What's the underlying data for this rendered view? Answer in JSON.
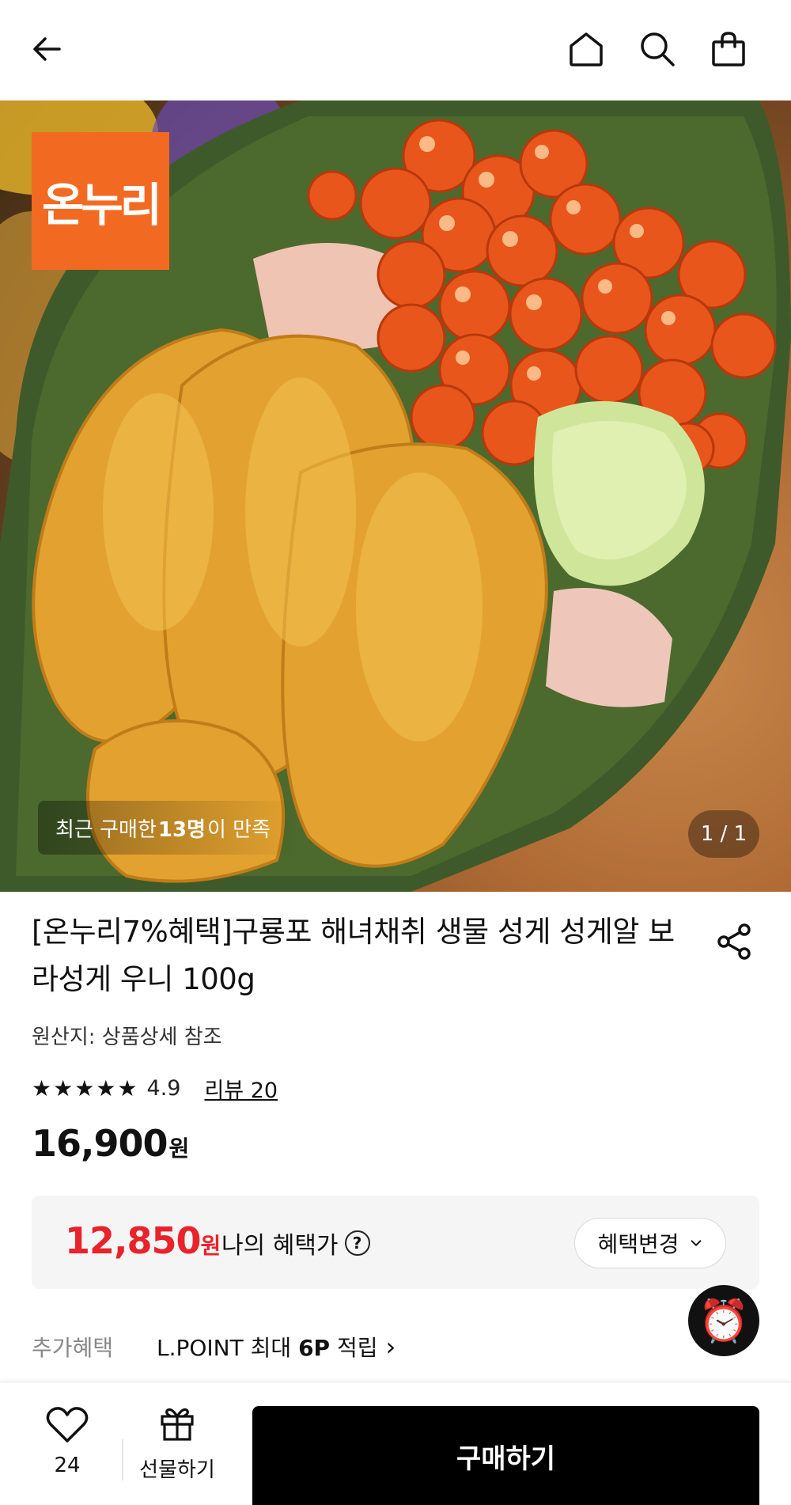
{
  "header": {
    "back_icon": "back-arrow-icon",
    "home_icon": "home-icon",
    "search_icon": "search-icon",
    "cart_icon": "shopping-bag-icon"
  },
  "hero": {
    "brand_logo_text": "온누리",
    "satisfaction_prefix": "최근 구매한 ",
    "satisfaction_count": "13명",
    "satisfaction_suffix": "이 만족",
    "page_indicator": "1 / 1"
  },
  "product": {
    "title": "[온누리7%혜택]구룡포 해녀채취 생물 성게 성게알 보라성게 우니 100g",
    "origin": "원산지: 상품상세 참조",
    "stars": "★★★★★",
    "rating": "4.9",
    "review_link": "리뷰 20",
    "price": "16,900",
    "price_unit": "원"
  },
  "benefit": {
    "price": "12,850",
    "price_unit": "원",
    "label": "나의 혜택가",
    "help_icon": "?",
    "change_button": "혜택변경",
    "change_chevron": "⌄"
  },
  "extra": {
    "label": "추가혜택",
    "text_prefix": "L.POINT 최대 ",
    "text_bold": "6P",
    "text_suffix": " 적립",
    "chevron": "›"
  },
  "alarm_icon": "⏰",
  "bottom_bar": {
    "like_count": "24",
    "gift_label": "선물하기",
    "buy_label": "구매하기"
  },
  "colors": {
    "logo_bg": "#f26a21",
    "benefit_price": "#e8232a",
    "buy_button": "#000000"
  }
}
